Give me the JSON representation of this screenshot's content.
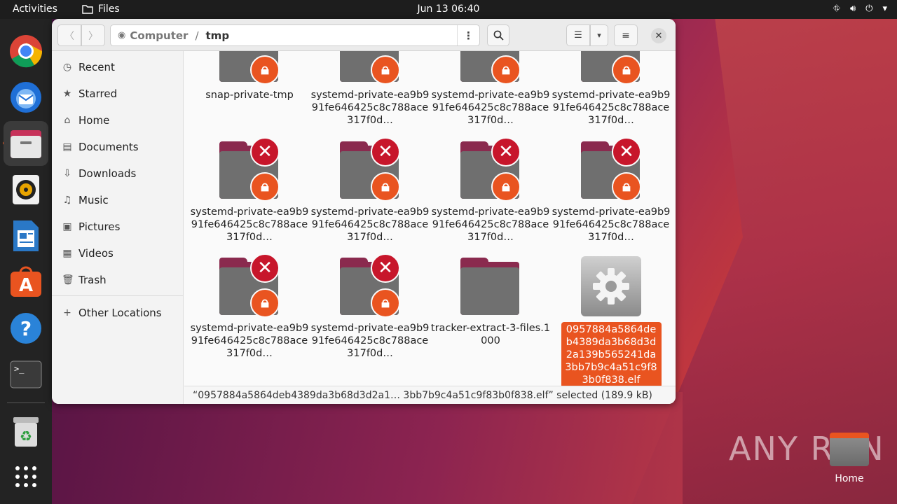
{
  "topbar": {
    "activities": "Activities",
    "app_name": "Files",
    "clock": "Jun 13  06:40"
  },
  "window": {
    "path": [
      "Computer",
      "tmp"
    ],
    "status": "“0957884a5864deb4389da3b68d3d2a1…  3bb7b9c4a51c9f83b0f838.elf” selected  (189.9 kB)"
  },
  "sidebar": {
    "items": [
      {
        "label": "Recent",
        "icon": "clock-icon"
      },
      {
        "label": "Starred",
        "icon": "star-icon"
      },
      {
        "label": "Home",
        "icon": "home-icon"
      },
      {
        "label": "Documents",
        "icon": "document-icon"
      },
      {
        "label": "Downloads",
        "icon": "download-icon"
      },
      {
        "label": "Music",
        "icon": "music-icon"
      },
      {
        "label": "Pictures",
        "icon": "picture-icon"
      },
      {
        "label": "Videos",
        "icon": "video-icon"
      },
      {
        "label": "Trash",
        "icon": "trash-icon"
      }
    ],
    "other": "Other Locations"
  },
  "files": [
    {
      "name": "snap-private-tmp"
    },
    {
      "name": "systemd-private-ea9b991fe646425c8c788ace317f0d…"
    },
    {
      "name": "systemd-private-ea9b991fe646425c8c788ace317f0d…"
    },
    {
      "name": "systemd-private-ea9b991fe646425c8c788ace317f0d…"
    },
    {
      "name": "systemd-private-ea9b991fe646425c8c788ace317f0d…"
    },
    {
      "name": "systemd-private-ea9b991fe646425c8c788ace317f0d…"
    },
    {
      "name": "systemd-private-ea9b991fe646425c8c788ace317f0d…"
    },
    {
      "name": "systemd-private-ea9b991fe646425c8c788ace317f0d…"
    },
    {
      "name": "systemd-private-ea9b991fe646425c8c788ace317f0d…"
    },
    {
      "name": "systemd-private-ea9b991fe646425c8c788ace317f0d…"
    },
    {
      "name": "tracker-extract-3-files.1000"
    },
    {
      "name": "0957884a5864deb4389da3b68d3d2a139b565241da3bb7b9c4a51c9f83b0f838.elf"
    }
  ],
  "desktop": {
    "home_label": "Home",
    "watermark": "ANY RUN"
  },
  "colors": {
    "accent": "#e95420",
    "deny": "#c7162b",
    "folder_tab": "#8a2a4e",
    "folder_body": "#6f6f6f"
  }
}
